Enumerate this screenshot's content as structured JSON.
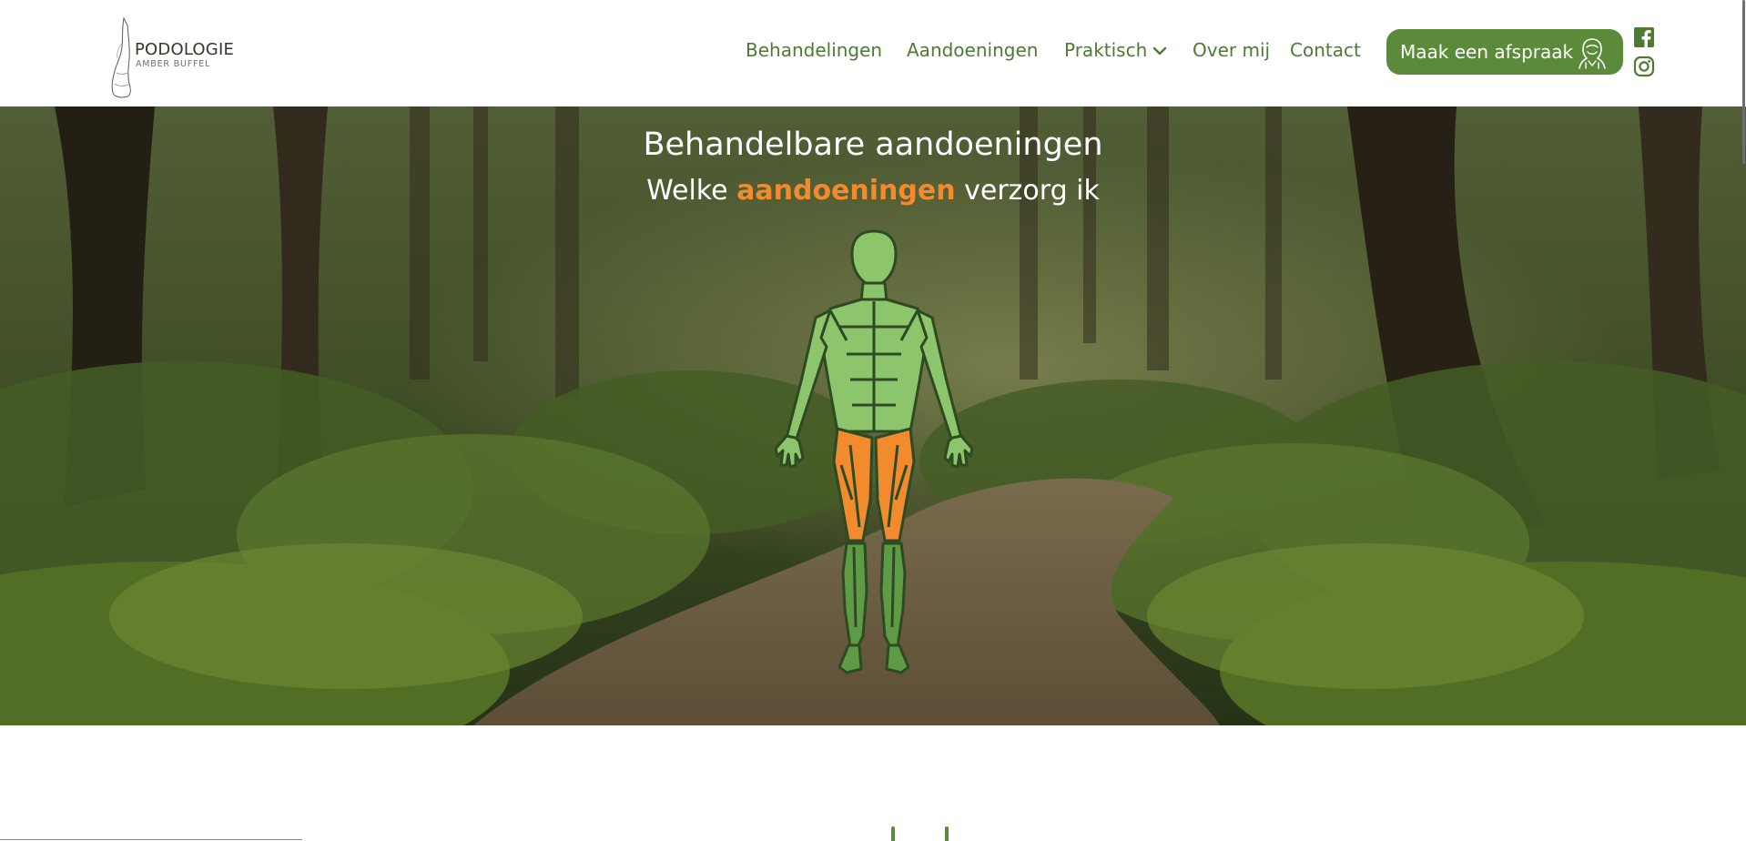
{
  "brand": {
    "name": "PODOLOGIE",
    "tagline": "AMBER BUFFEL",
    "logo_icon": "foot-sketch-icon"
  },
  "nav": {
    "items": [
      {
        "label": "Behandelingen"
      },
      {
        "label": "Aandoeningen"
      },
      {
        "label": "Praktisch",
        "has_dropdown": true
      },
      {
        "label": "Over mij"
      },
      {
        "label": "Contact"
      }
    ],
    "cta_label": "Maak een afspraak",
    "cta_icon": "person-outline-icon",
    "social": [
      "facebook-icon",
      "instagram-icon"
    ]
  },
  "hero": {
    "title": "Behandelbare aandoeningen",
    "subtitle_before": "Welke",
    "subtitle_highlight": "aandoeningen",
    "subtitle_after": "verzorg ik",
    "background": "forest path",
    "figure": "interactive-body-map",
    "highlighted_region": "upper legs"
  },
  "colors": {
    "brand_green": "#5b8b3a",
    "nav_text": "#4f7a33",
    "accent_orange": "#f28a2e",
    "body_green_light": "#8cc56b",
    "body_green_dark": "#5f9a47"
  }
}
